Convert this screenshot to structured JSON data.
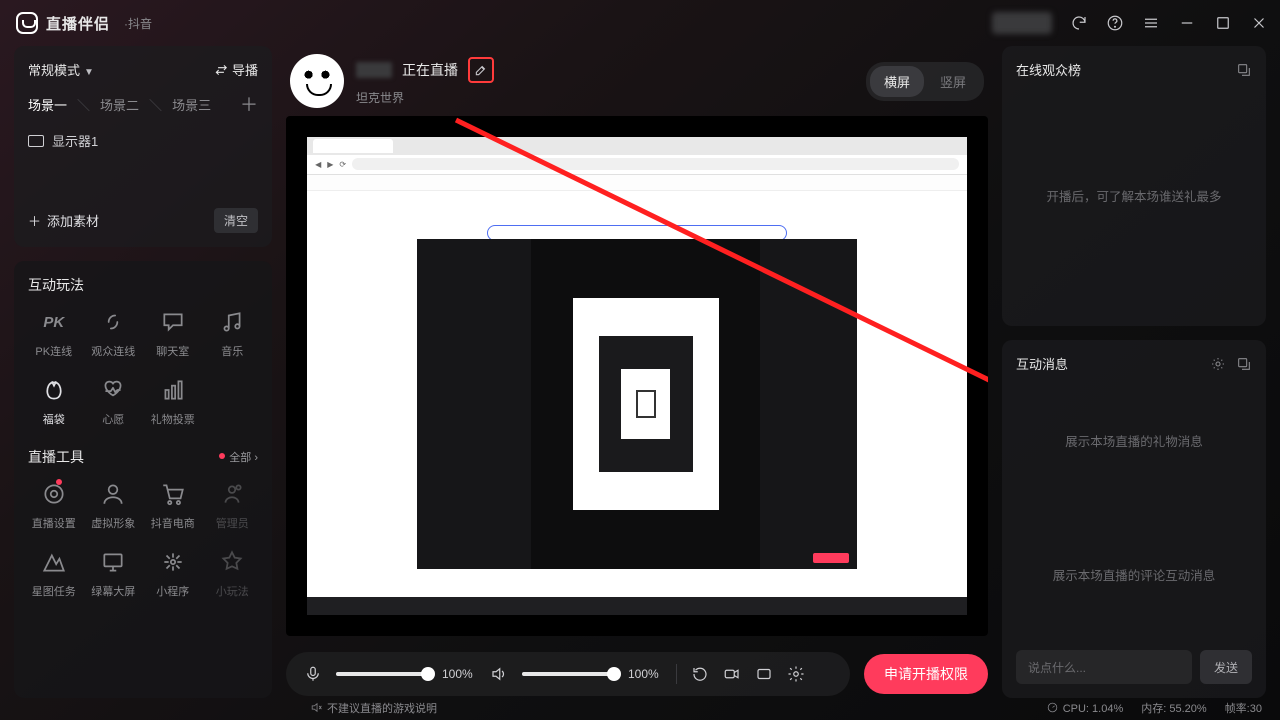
{
  "app": {
    "name": "直播伴侣",
    "subtitle": "·抖音"
  },
  "titlebar_icons": [
    "refresh-icon",
    "help-icon",
    "menu-icon",
    "minimize-icon",
    "maximize-icon",
    "close-icon"
  ],
  "left": {
    "mode_label": "常规模式",
    "guide_label": "导播",
    "scenes": [
      "场景一",
      "场景二",
      "场景三"
    ],
    "active_scene": 0,
    "monitor": "显示器1",
    "add_material": "添加素材",
    "clear": "清空",
    "interactive_title": "互动玩法",
    "interactive_items": [
      {
        "id": "pk",
        "label": "PK连线"
      },
      {
        "id": "audience-link",
        "label": "观众连线"
      },
      {
        "id": "chatroom",
        "label": "聊天室"
      },
      {
        "id": "music",
        "label": "音乐"
      },
      {
        "id": "lucky-bag",
        "label": "福袋",
        "highlight": true
      },
      {
        "id": "wish",
        "label": "心愿"
      },
      {
        "id": "gift-vote",
        "label": "礼物投票"
      }
    ],
    "tools_title": "直播工具",
    "tools_all": "全部",
    "tools_items": [
      {
        "id": "live-settings",
        "label": "直播设置",
        "dot": true
      },
      {
        "id": "virtual-avatar",
        "label": "虚拟形象"
      },
      {
        "id": "douyin-commerce",
        "label": "抖音电商"
      },
      {
        "id": "admin",
        "label": "管理员",
        "dim": true
      },
      {
        "id": "xingtu",
        "label": "星图任务"
      },
      {
        "id": "green-screen",
        "label": "绿幕大屏"
      },
      {
        "id": "miniapp",
        "label": "小程序"
      },
      {
        "id": "mini-games",
        "label": "小玩法",
        "dim": true
      }
    ]
  },
  "mid": {
    "live_status": "正在直播",
    "category": "坦克世界",
    "orientation": {
      "landscape": "横屏",
      "portrait": "竖屏",
      "active": "landscape"
    },
    "mic_pct": "100%",
    "mic_val": 100,
    "spk_pct": "100%",
    "spk_val": 100,
    "apply_btn": "申请开播权限"
  },
  "right": {
    "viewers_title": "在线观众榜",
    "viewers_empty": "开播后，可了解本场谁送礼最多",
    "messages_title": "互动消息",
    "gift_empty": "展示本场直播的礼物消息",
    "comment_empty": "展示本场直播的评论互动消息",
    "chat_placeholder": "说点什么...",
    "send": "发送"
  },
  "status": {
    "warning": "不建议直播的游戏说明",
    "cpu_label": "CPU:",
    "cpu_val": "1.04%",
    "mem_label": "内存:",
    "mem_val": "55.20%",
    "fps_label": "帧率:",
    "fps_val": "30"
  }
}
